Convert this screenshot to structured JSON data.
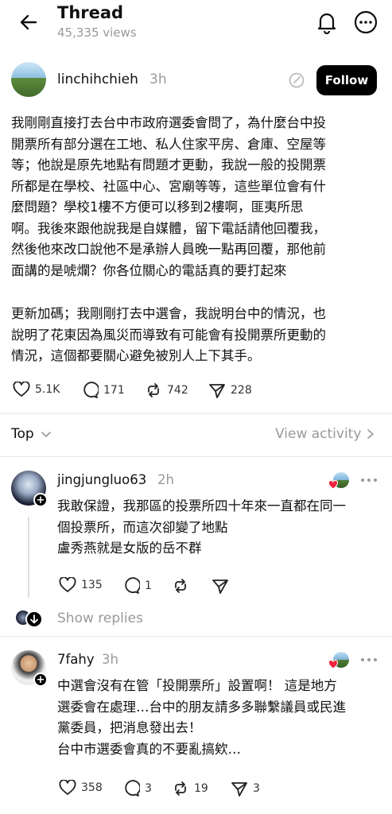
{
  "header": {
    "title": "Thread",
    "views": "45,335 views"
  },
  "post": {
    "author": "linchihchieh",
    "time": "3h",
    "follow_label": "Follow",
    "paragraph1": "我剛剛直接打去台中市政府選委會問了，為什麼台中投\n開票所有部分選在工地、私人住家平房、倉庫、空屋等\n等；他說是原先地點有問題才更動，我說一般的投開票\n所都是在學校、社區中心、宮廟等等，這些單位會有什\n麼問題？學校1樓不方便可以移到2樓啊，匪夷所思\n啊。我後來跟他說我是自媒體，留下電話請他回覆我，\n然後他來改口說他不是承辦人員晚一點再回覆，那他前\n面講的是唬爛？你各位關心的電話真的要打起來",
    "paragraph2": "更新加碼；我剛剛打去中選會，我說明台中的情況，也\n說明了花東因為風災而導致有可能會有投開票所更動的\n情況，這個都要關心避免被別人上下其手。",
    "likes": "5.1K",
    "comments": "171",
    "reposts": "742",
    "shares": "228"
  },
  "sort": {
    "label": "Top",
    "view_activity": "View activity"
  },
  "replies": [
    {
      "user": "jingjungluo63",
      "time": "2h",
      "text": "我敢保證，我那區的投票所四十年來一直都在同一\n個投票所，而這次卻變了地點\n盧秀燕就是女版的岳不群",
      "likes": "135",
      "comments": "1",
      "reposts": "",
      "shares": ""
    },
    {
      "user": "7fahy",
      "time": "3h",
      "text": "中選會沒有在管「投開票所」設置啊！ 這是地方\n選委會在處理…台中的朋友請多多聯繫議員或民進\n黨委員，把消息發出去！\n台中市選委會真的不要亂搞欸…",
      "likes": "358",
      "comments": "3",
      "reposts": "19",
      "shares": "3"
    }
  ],
  "show_replies": "Show replies",
  "icons": {
    "back": "arrow-left-icon",
    "bell": "bell-icon",
    "more": "more-horizontal-icon",
    "heart": "heart-icon",
    "comment": "comment-icon",
    "repost": "repost-icon",
    "share": "send-icon"
  }
}
